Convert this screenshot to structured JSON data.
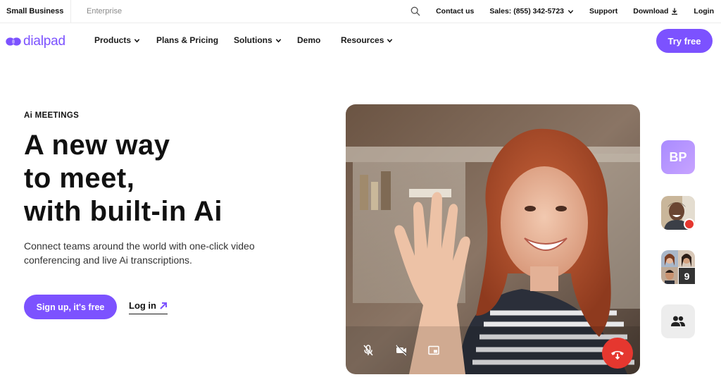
{
  "utility_bar": {
    "segments": [
      "Small Business",
      "Enterprise"
    ],
    "links": {
      "contact": "Contact us",
      "sales": "Sales: (855) 342-5723",
      "support": "Support",
      "download": "Download",
      "login": "Login"
    }
  },
  "nav": {
    "logo_text": "dialpad",
    "items": [
      "Products",
      "Plans & Pricing",
      "Solutions",
      "Demo",
      "Resources"
    ],
    "cta": "Try free"
  },
  "hero": {
    "eyebrow": "Ai MEETINGS",
    "headline": [
      "A new way",
      "to meet,",
      "with built-in Ai"
    ],
    "subtext": "Connect teams around the world with one-click video conferencing and live Ai transcriptions.",
    "primary_cta": "Sign up, it's free",
    "secondary_cta": "Log in"
  },
  "video_panel": {
    "controls": [
      "mic-muted-icon",
      "camera-off-icon",
      "picture-in-picture-icon",
      "end-call-icon"
    ]
  },
  "participants_rail": {
    "initials": "BP",
    "extra_count": "9"
  },
  "colors": {
    "brand": "#7c52ff",
    "end_call": "#e5372f",
    "text": "#111111"
  }
}
